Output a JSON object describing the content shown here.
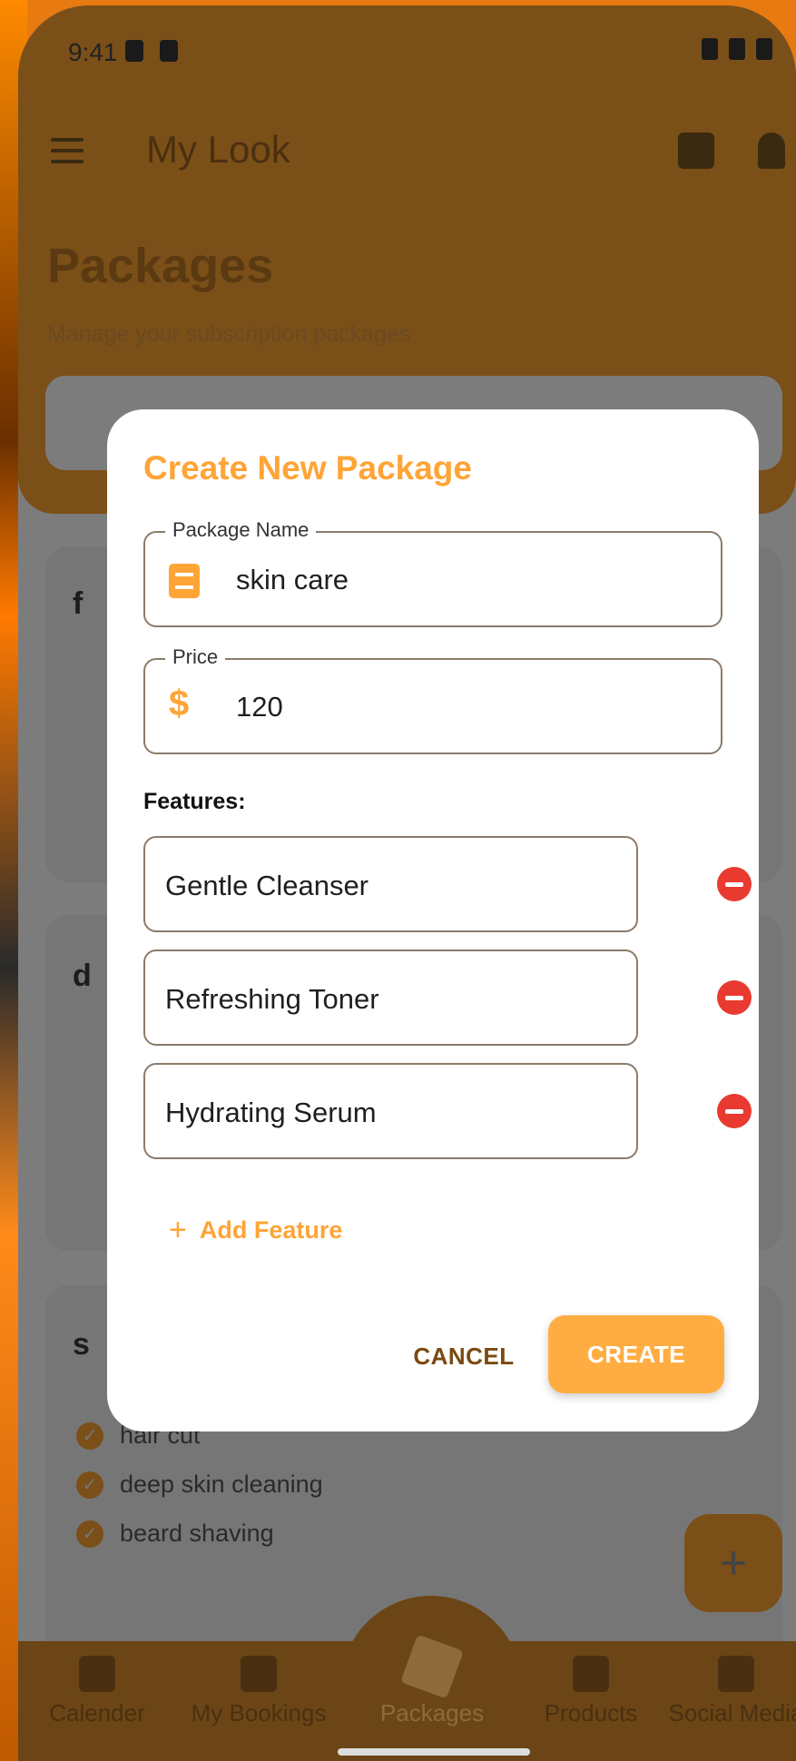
{
  "status_bar": {
    "time": "9:41"
  },
  "app": {
    "title": "My Look"
  },
  "page": {
    "heading": "Packages",
    "subtitle": "Manage your subscription packages"
  },
  "background_cards": [
    {
      "name_initial": "f"
    },
    {
      "name_initial": "d"
    },
    {
      "name_initial": "s"
    }
  ],
  "visible_features": [
    "hair cut",
    "deep skin cleaning",
    "beard shaving"
  ],
  "bottom_nav": {
    "items": [
      "Calender",
      "My Bookings",
      "Packages",
      "Products",
      "Social Media"
    ],
    "active": "Packages"
  },
  "dialog": {
    "title": "Create New Package",
    "package_name_label": "Package Name",
    "package_name_value": "skin care",
    "price_label": "Price",
    "price_value": "120",
    "features_label": "Features:",
    "features": [
      "Gentle Cleanser",
      "Refreshing Toner",
      "Hydrating Serum"
    ],
    "add_feature_label": "Add Feature",
    "cancel_label": "CANCEL",
    "create_label": "CREATE"
  },
  "colors": {
    "accent": "#ffa436",
    "remove": "#e83a30",
    "scrim_appbar": "#7b4f18"
  },
  "icons": {
    "package_name": "clipboard-icon",
    "price": "dollar-icon",
    "remove": "remove-circle-icon",
    "add": "plus-icon"
  }
}
